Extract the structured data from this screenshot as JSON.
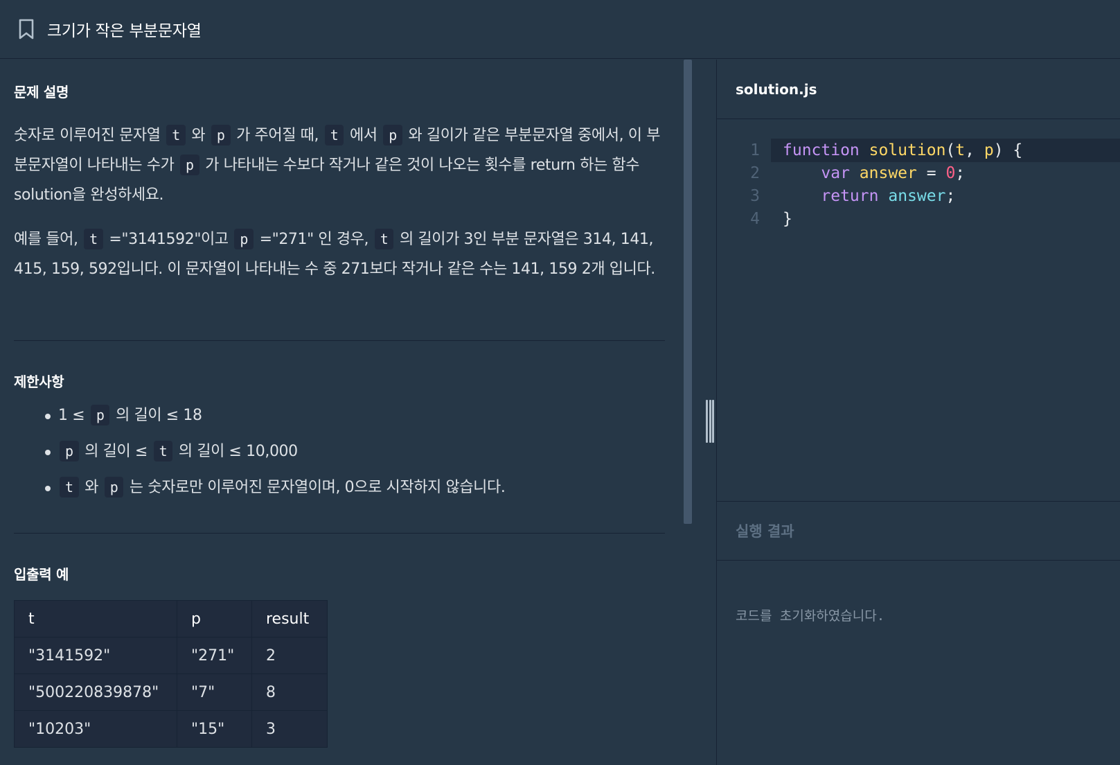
{
  "header": {
    "title": "크기가 작은 부분문자열",
    "bookmark_icon": "bookmark-icon"
  },
  "problem": {
    "section_title": "문제 설명",
    "para1": [
      {
        "t": "숫자로 이루어진 문자열 "
      },
      {
        "c": "t"
      },
      {
        "t": " 와 "
      },
      {
        "c": "p"
      },
      {
        "t": " 가 주어질 때, "
      },
      {
        "c": "t"
      },
      {
        "t": " 에서 "
      },
      {
        "c": "p"
      },
      {
        "t": " 와 길이가 같은 부분문자열 중에서, 이 부분문자열이 나타내는 수가 "
      },
      {
        "c": "p"
      },
      {
        "t": " 가 나타내는 수보다 작거나 같은 것이 나오는 횟수를 return 하는 함수 solution을 완성하세요."
      }
    ],
    "para2": [
      {
        "t": "예를 들어, "
      },
      {
        "c": "t"
      },
      {
        "t": " =\"3141592\"이고 "
      },
      {
        "c": "p"
      },
      {
        "t": " =\"271\" 인 경우, "
      },
      {
        "c": "t"
      },
      {
        "t": " 의 길이가 3인 부분 문자열은 314, 141, 415, 159, 592입니다. 이 문자열이 나타내는 수 중 271보다 작거나 같은 수는 141, 159 2개 입니다."
      }
    ]
  },
  "constraints": {
    "section_title": "제한사항",
    "items": [
      [
        {
          "t": "1 ≤ "
        },
        {
          "c": "p"
        },
        {
          "t": " 의 길이 ≤ 18"
        }
      ],
      [
        {
          "c": "p"
        },
        {
          "t": " 의 길이 ≤ "
        },
        {
          "c": "t"
        },
        {
          "t": " 의 길이 ≤ 10,000"
        }
      ],
      [
        {
          "c": "t"
        },
        {
          "t": " 와 "
        },
        {
          "c": "p"
        },
        {
          "t": " 는 숫자로만 이루어진 문자열이며, 0으로 시작하지 않습니다."
        }
      ]
    ]
  },
  "examples": {
    "section_title": "입출력 예",
    "headers": [
      "t",
      "p",
      "result"
    ],
    "rows": [
      [
        "\"3141592\"",
        "\"271\"",
        "2"
      ],
      [
        "\"500220839878\"",
        "\"7\"",
        "8"
      ],
      [
        "\"10203\"",
        "\"15\"",
        "3"
      ]
    ]
  },
  "editor": {
    "file_name": "solution.js",
    "line_numbers": [
      "1",
      "2",
      "3",
      "4"
    ],
    "lines": [
      [
        {
          "k": "kw",
          "t": "function"
        },
        {
          "k": "pl",
          "t": " "
        },
        {
          "k": "fn",
          "t": "solution"
        },
        {
          "k": "pl",
          "t": "("
        },
        {
          "k": "par",
          "t": "t"
        },
        {
          "k": "pl",
          "t": ", "
        },
        {
          "k": "par",
          "t": "p"
        },
        {
          "k": "pl",
          "t": ") {"
        }
      ],
      [
        {
          "k": "pl",
          "t": "    "
        },
        {
          "k": "kw",
          "t": "var"
        },
        {
          "k": "pl",
          "t": " "
        },
        {
          "k": "fn",
          "t": "answer"
        },
        {
          "k": "pl",
          "t": " = "
        },
        {
          "k": "nm",
          "t": "0"
        },
        {
          "k": "pl",
          "t": ";"
        }
      ],
      [
        {
          "k": "pl",
          "t": "    "
        },
        {
          "k": "kw",
          "t": "return"
        },
        {
          "k": "pl",
          "t": " "
        },
        {
          "k": "vr",
          "t": "answer"
        },
        {
          "k": "pl",
          "t": ";"
        }
      ],
      [
        {
          "k": "pl",
          "t": "}"
        }
      ]
    ]
  },
  "result": {
    "title": "실행 결과",
    "message": "코드를 초기화하였습니다."
  }
}
